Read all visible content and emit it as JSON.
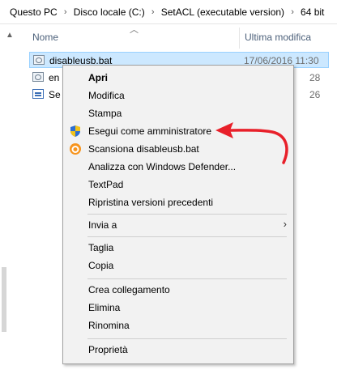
{
  "breadcrumb": {
    "items": [
      "Questo PC",
      "Disco locale (C:)",
      "SetACL (executable version)",
      "64 bit"
    ],
    "separator": "›"
  },
  "columns": {
    "name": "Nome",
    "modified": "Ultima modifica",
    "sort_icon": "sort-up-icon"
  },
  "files": [
    {
      "name": "disableusb.bat",
      "date": "17/06/2016 11:30",
      "icon": "batch-file-icon",
      "selected": true
    },
    {
      "name": "en",
      "date": "28",
      "icon": "batch-file-icon",
      "selected": false
    },
    {
      "name": "Se",
      "date": "26",
      "icon": "executable-icon",
      "selected": false
    }
  ],
  "context_menu": {
    "items": [
      {
        "label": "Apri",
        "bold": true
      },
      {
        "label": "Modifica"
      },
      {
        "label": "Stampa"
      },
      {
        "label": "Esegui come amministratore",
        "icon": "uac-shield-icon"
      },
      {
        "label": "Scansiona disableusb.bat",
        "icon": "avast-icon"
      },
      {
        "label": "Analizza con Windows Defender..."
      },
      {
        "label": "TextPad"
      },
      {
        "label": "Ripristina versioni precedenti"
      },
      {
        "label": "Invia a",
        "submenu": true
      },
      {
        "label": "Taglia"
      },
      {
        "label": "Copia"
      },
      {
        "label": "Crea collegamento"
      },
      {
        "label": "Elimina"
      },
      {
        "label": "Rinomina"
      },
      {
        "label": "Proprietà"
      }
    ]
  },
  "colors": {
    "selection": "#cce8ff",
    "menu_bg": "#f2f2f2",
    "annotation_arrow": "#e8202a"
  }
}
